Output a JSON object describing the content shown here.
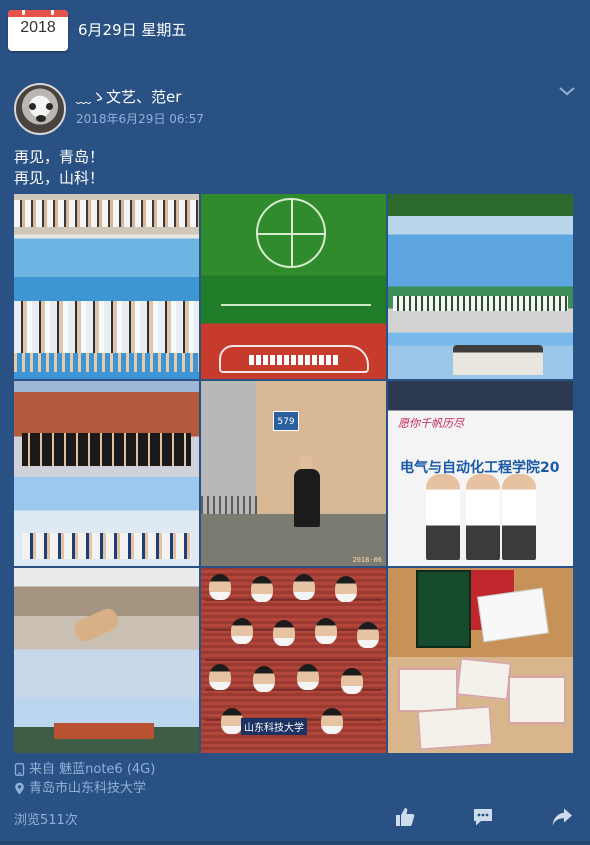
{
  "date_header": {
    "year": "2018",
    "date": "6月29日 星期五"
  },
  "post": {
    "username": "﹏ゝ文艺、范er",
    "timestamp": "2018年6月29日 06:57",
    "text_lines": [
      "再见，青岛！",
      "再见，山科！"
    ],
    "photo_labels": {
      "building_number": "579",
      "photo_date_stamp": "2018-06",
      "banner_slogan": "愿你千帆历尽",
      "banner_text": "电气与自动化工程学院20",
      "university_name": "山东科技大学"
    },
    "device": "来自 魅蓝note6 (4G)",
    "location": "青岛市山东科技大学",
    "views": "浏览511次"
  },
  "colors": {
    "background": "#2a5183",
    "meta_text": "#8fb1d8",
    "calendar_red": "#e5534b"
  },
  "icons": [
    "calendar-icon",
    "chevron-down-icon",
    "phone-icon",
    "location-pin-icon",
    "like-icon",
    "comment-icon",
    "share-icon"
  ]
}
